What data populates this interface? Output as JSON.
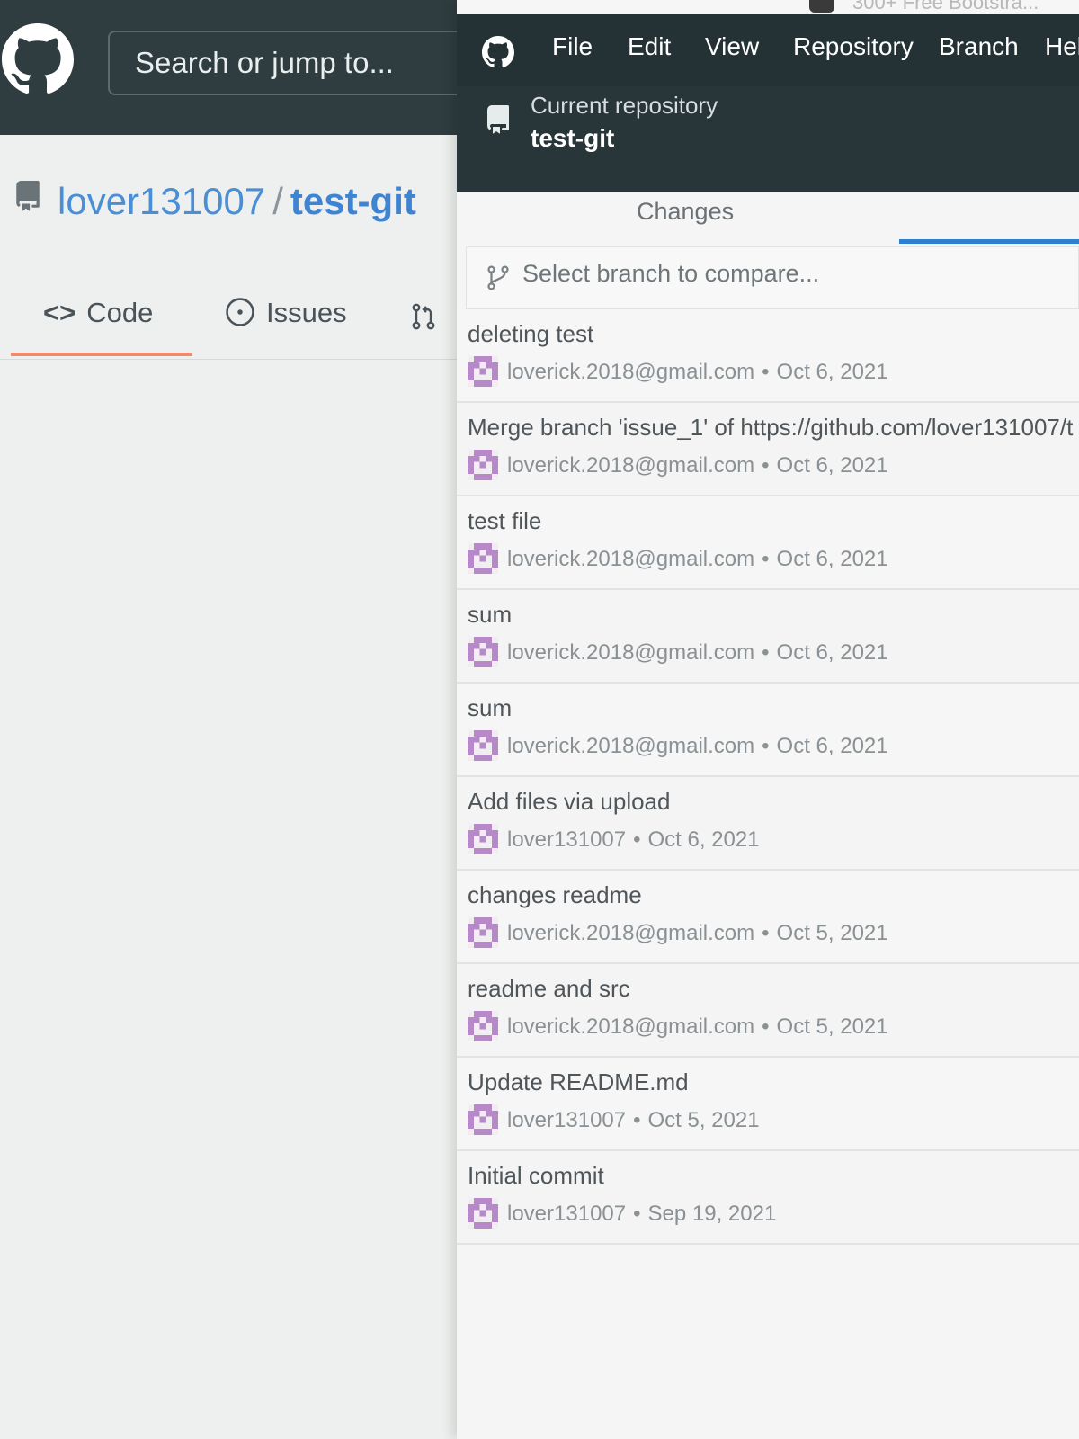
{
  "github_web": {
    "search_placeholder": "Search or jump to...",
    "repo_owner": "lover131007",
    "repo_separator": "/",
    "repo_name": "test-git",
    "tabs": [
      {
        "label": "Code"
      },
      {
        "label": "Issues"
      }
    ]
  },
  "desktop": {
    "tooltip_text": "300+ Free Bootstra...",
    "menu": [
      "File",
      "Edit",
      "View",
      "Repository",
      "Branch",
      "Hel"
    ],
    "current_repo_label": "Current repository",
    "current_repo_name": "test-git",
    "tab_changes": "Changes",
    "branch_compare_placeholder": "Select branch to compare...",
    "commits": [
      {
        "title": "deleting test",
        "author": "loverick.2018@gmail.com",
        "date": "Oct 6, 2021"
      },
      {
        "title": "Merge branch 'issue_1' of https://github.com/lover131007/t",
        "author": "loverick.2018@gmail.com",
        "date": "Oct 6, 2021"
      },
      {
        "title": "test file",
        "author": "loverick.2018@gmail.com",
        "date": "Oct 6, 2021"
      },
      {
        "title": "sum",
        "author": "loverick.2018@gmail.com",
        "date": "Oct 6, 2021"
      },
      {
        "title": "sum",
        "author": "loverick.2018@gmail.com",
        "date": "Oct 6, 2021"
      },
      {
        "title": "Add files via upload",
        "author": "lover131007",
        "date": "Oct 6, 2021"
      },
      {
        "title": "changes readme",
        "author": "loverick.2018@gmail.com",
        "date": "Oct 5, 2021"
      },
      {
        "title": "readme and src",
        "author": "loverick.2018@gmail.com",
        "date": "Oct 5, 2021"
      },
      {
        "title": "Update README.md",
        "author": "lover131007",
        "date": "Oct 5, 2021"
      },
      {
        "title": "Initial commit",
        "author": "lover131007",
        "date": "Sep 19, 2021"
      }
    ],
    "meta_separator": "•"
  },
  "icons": {
    "github_logo": "github-logo-icon",
    "repo": "repo-icon",
    "code": "code-icon",
    "issues": "issue-opened-icon",
    "pull_request": "git-pull-request-icon",
    "branch": "git-branch-icon",
    "avatar": "identicon-avatar"
  },
  "colors": {
    "header_dark": "#2f3d40",
    "desktop_menubar": "#243236",
    "link_blue": "#3e84d2",
    "tab_underline_orange": "#f08a6f",
    "history_underline_blue": "#2d7fd1",
    "avatar_purple": "#b889c8"
  }
}
